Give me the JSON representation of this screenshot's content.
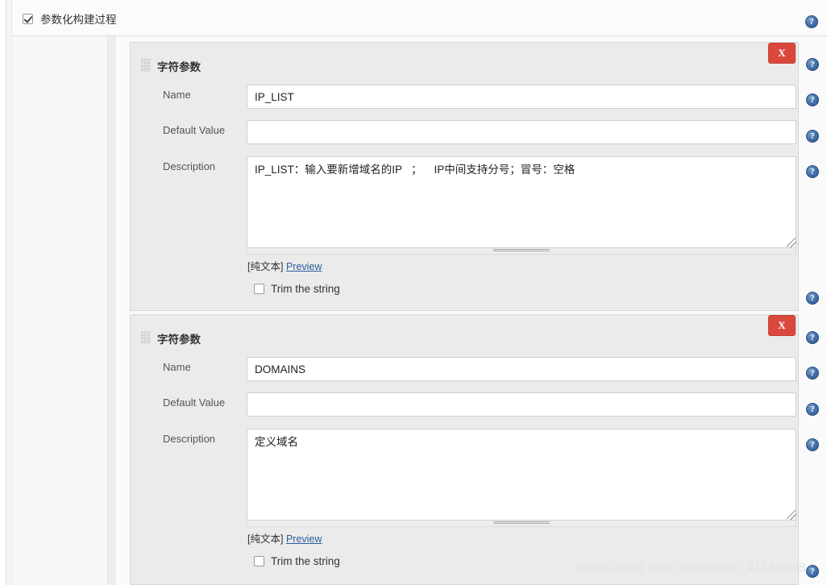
{
  "header": {
    "checkbox_checked": true,
    "title": "参数化构建过程",
    "help_icon": "help-icon"
  },
  "theme": {
    "page_bg": "#ffffff",
    "panel_bg": "#ebebeb",
    "body_bg": "#fafafa",
    "input_bg": "#ffffff",
    "delete_button": "#d9483b",
    "link_color": "#2b5d9b",
    "label_color": "#555555",
    "help_icon_color": "#3d6497"
  },
  "labels": {
    "name": "Name",
    "default_value": "Default Value",
    "description": "Description",
    "preview_prefix": "[纯文本]",
    "preview_link": "Preview",
    "trim": "Trim the string",
    "delete": "X"
  },
  "parameters": [
    {
      "section_title": "字符参数",
      "name_value": "IP_LIST",
      "name_placeholder": "",
      "default_value": "",
      "default_placeholder": "",
      "description_value": "IP_LIST：输入要新增域名的IP   ；    IP中间支持分号；冒号：空格",
      "description_placeholder": "",
      "trim_checked": false
    },
    {
      "section_title": "字符参数",
      "name_value": "DOMAINS",
      "name_placeholder": "",
      "default_value": "",
      "default_placeholder": "",
      "description_value": "定义域名",
      "description_placeholder": "",
      "trim_checked": false
    }
  ],
  "watermark": "https://blog.csdn.net/weixin_41569908"
}
